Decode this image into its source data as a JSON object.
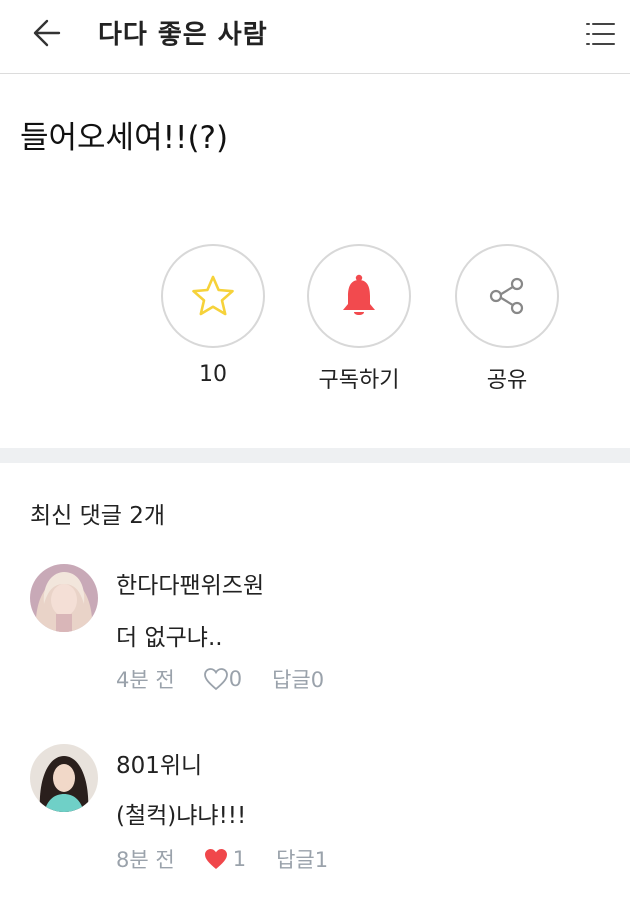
{
  "header": {
    "title": "다다 좋은 사람"
  },
  "post": {
    "title": "들어오세여!!(?)"
  },
  "actions": {
    "favorite_count": "10",
    "subscribe_label": "구독하기",
    "share_label": "공유"
  },
  "comments_header": "최신 댓글 2개",
  "comments": [
    {
      "author": "한다다팬위즈원",
      "text": "더 없구냐..",
      "time": "4분 전",
      "likes": "0",
      "liked": false,
      "reply": "답글0"
    },
    {
      "author": "801위니",
      "text": "(철컥)냐냐!!!",
      "time": "8분 전",
      "likes": "1",
      "liked": true,
      "reply": "답글1"
    }
  ],
  "colors": {
    "star": "#f6d23a",
    "bell": "#f24a4e",
    "heart_liked": "#f0474b",
    "meta": "#9aa2ab",
    "divider": "#eef0f2"
  },
  "icons": [
    "back-arrow-icon",
    "menu-icon",
    "star-icon",
    "bell-icon",
    "share-icon",
    "heart-outline-icon",
    "heart-filled-icon"
  ]
}
